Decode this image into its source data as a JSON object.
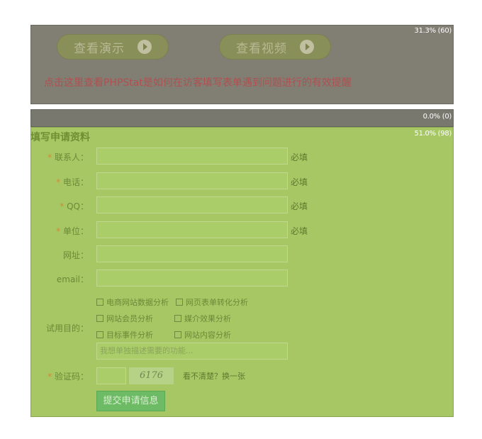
{
  "panel1": {
    "percent": "31.3% (60)",
    "btn_demo": "查看演示",
    "btn_video": "查看视频",
    "hint": "点击这里查看PHPStat是如何在访客填写表单遇到问题进行的有效提醒"
  },
  "panel2": {
    "percent": "0.0% (0)"
  },
  "form": {
    "percent": "51.0% (98)",
    "title": "填写申请资料",
    "required_mark": "*",
    "fields": {
      "contact": "联系人：",
      "phone": "电话：",
      "qq": "QQ：",
      "company": "单位：",
      "website": "网址：",
      "email": "email："
    },
    "must_label": "必填",
    "purpose_label": "试用目的：",
    "purposes": [
      "电商网站数据分析",
      "网页表单转化分析",
      "网站会员分析",
      "媒介效果分析",
      "目标事件分析",
      "网站内容分析"
    ],
    "purpose_placeholder": "我想单独描述需要的功能...",
    "captcha_label": "验证码：",
    "captcha_text": "6176",
    "refresh": "看不清楚？换一张",
    "submit": "提交申请信息"
  }
}
